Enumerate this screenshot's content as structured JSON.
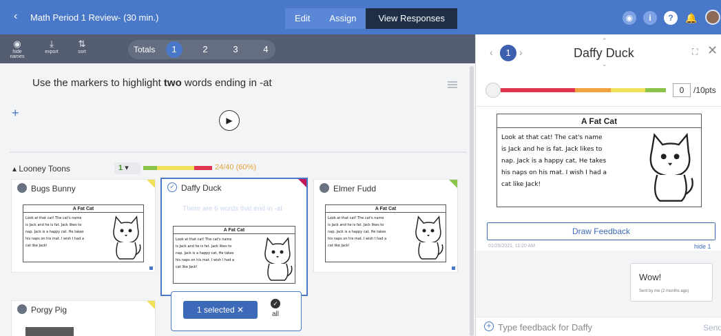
{
  "header": {
    "back_icon": "chevron-left-icon",
    "title": "Math Period 1 Review- (30 min.)",
    "modes": [
      "Edit",
      "Assign",
      "View Responses"
    ],
    "active_mode": "View Responses",
    "icons": [
      "eye-icon",
      "info-icon",
      "help-icon",
      "bell-icon",
      "avatar"
    ]
  },
  "toolbar": {
    "tools": [
      {
        "icon": "hide-names-icon",
        "label": "hide names"
      },
      {
        "icon": "export-icon",
        "label": "export"
      },
      {
        "icon": "sort-icon",
        "label": "sort"
      }
    ],
    "totals_label": "Totals",
    "questions": [
      "1",
      "2",
      "3",
      "4"
    ],
    "active_question": "1"
  },
  "question": {
    "text_before": "Use the markers to highlight ",
    "bold": "two",
    "text_after": " words ending in -at"
  },
  "group": {
    "name": "Looney Toons",
    "selector": "1",
    "score": "24/40 (60%)",
    "score_fraction": 0.6
  },
  "worksheet": {
    "title": "A Fat Cat",
    "lines": [
      "Look at that cat!  The cat's name",
      "is Jack and he is fat.  Jack likes to",
      "nap.  Jack is a happy cat.  He takes",
      "his naps on his mat.  I wish I had a",
      "cat like Jack!"
    ]
  },
  "students": [
    {
      "name": "Bugs Bunny",
      "flag": "yellow"
    },
    {
      "name": "Daffy Duck",
      "flag": "pink",
      "typed": "There are 6 words that end in -at"
    },
    {
      "name": "Elmer Fudd",
      "flag": "green"
    },
    {
      "name": "Porgy Pig",
      "flag": "yellow"
    }
  ],
  "selection": {
    "selected_label": "1 selected",
    "clear_icon": "close-icon",
    "all_label": "all"
  },
  "panel": {
    "student": "Daffy Duck",
    "question_num": "1",
    "points_value": "0",
    "points_label": "/10pts",
    "draw_feedback": "Draw Feedback",
    "timestamp": "01/25/2021, 11:20 AM",
    "hide_label": "hide 1",
    "feedback": {
      "message": "Wow!",
      "meta": "Sent by me (2 months ago)"
    },
    "input_placeholder": "Type feedback for Daffy",
    "send_label": "Send"
  },
  "colors": {
    "brand": "#4a78c9",
    "bar_red": "#e0364f",
    "bar_orange": "#f0a23e",
    "bar_yellow": "#f1e05a",
    "bar_green": "#8cc44b"
  }
}
